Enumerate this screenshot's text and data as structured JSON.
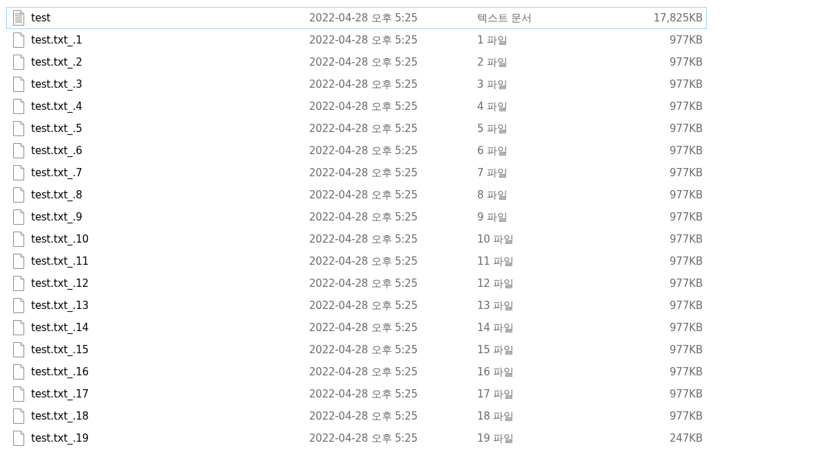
{
  "files": [
    {
      "name": "test",
      "date": "2022-04-28 오후 5:25",
      "type": "텍스트 문서",
      "size": "17,825KB",
      "kind": "text",
      "selected": true
    },
    {
      "name": "test.txt_.1",
      "date": "2022-04-28 오후 5:25",
      "type": "1 파일",
      "size": "977KB",
      "kind": "blank",
      "selected": false
    },
    {
      "name": "test.txt_.2",
      "date": "2022-04-28 오후 5:25",
      "type": "2 파일",
      "size": "977KB",
      "kind": "blank",
      "selected": false
    },
    {
      "name": "test.txt_.3",
      "date": "2022-04-28 오후 5:25",
      "type": "3 파일",
      "size": "977KB",
      "kind": "blank",
      "selected": false
    },
    {
      "name": "test.txt_.4",
      "date": "2022-04-28 오후 5:25",
      "type": "4 파일",
      "size": "977KB",
      "kind": "blank",
      "selected": false
    },
    {
      "name": "test.txt_.5",
      "date": "2022-04-28 오후 5:25",
      "type": "5 파일",
      "size": "977KB",
      "kind": "blank",
      "selected": false
    },
    {
      "name": "test.txt_.6",
      "date": "2022-04-28 오후 5:25",
      "type": "6 파일",
      "size": "977KB",
      "kind": "blank",
      "selected": false
    },
    {
      "name": "test.txt_.7",
      "date": "2022-04-28 오후 5:25",
      "type": "7 파일",
      "size": "977KB",
      "kind": "blank",
      "selected": false
    },
    {
      "name": "test.txt_.8",
      "date": "2022-04-28 오후 5:25",
      "type": "8 파일",
      "size": "977KB",
      "kind": "blank",
      "selected": false
    },
    {
      "name": "test.txt_.9",
      "date": "2022-04-28 오후 5:25",
      "type": "9 파일",
      "size": "977KB",
      "kind": "blank",
      "selected": false
    },
    {
      "name": "test.txt_.10",
      "date": "2022-04-28 오후 5:25",
      "type": "10 파일",
      "size": "977KB",
      "kind": "blank",
      "selected": false
    },
    {
      "name": "test.txt_.11",
      "date": "2022-04-28 오후 5:25",
      "type": "11 파일",
      "size": "977KB",
      "kind": "blank",
      "selected": false
    },
    {
      "name": "test.txt_.12",
      "date": "2022-04-28 오후 5:25",
      "type": "12 파일",
      "size": "977KB",
      "kind": "blank",
      "selected": false
    },
    {
      "name": "test.txt_.13",
      "date": "2022-04-28 오후 5:25",
      "type": "13 파일",
      "size": "977KB",
      "kind": "blank",
      "selected": false
    },
    {
      "name": "test.txt_.14",
      "date": "2022-04-28 오후 5:25",
      "type": "14 파일",
      "size": "977KB",
      "kind": "blank",
      "selected": false
    },
    {
      "name": "test.txt_.15",
      "date": "2022-04-28 오후 5:25",
      "type": "15 파일",
      "size": "977KB",
      "kind": "blank",
      "selected": false
    },
    {
      "name": "test.txt_.16",
      "date": "2022-04-28 오후 5:25",
      "type": "16 파일",
      "size": "977KB",
      "kind": "blank",
      "selected": false
    },
    {
      "name": "test.txt_.17",
      "date": "2022-04-28 오후 5:25",
      "type": "17 파일",
      "size": "977KB",
      "kind": "blank",
      "selected": false
    },
    {
      "name": "test.txt_.18",
      "date": "2022-04-28 오후 5:25",
      "type": "18 파일",
      "size": "977KB",
      "kind": "blank",
      "selected": false
    },
    {
      "name": "test.txt_.19",
      "date": "2022-04-28 오후 5:25",
      "type": "19 파일",
      "size": "247KB",
      "kind": "blank",
      "selected": false
    }
  ]
}
